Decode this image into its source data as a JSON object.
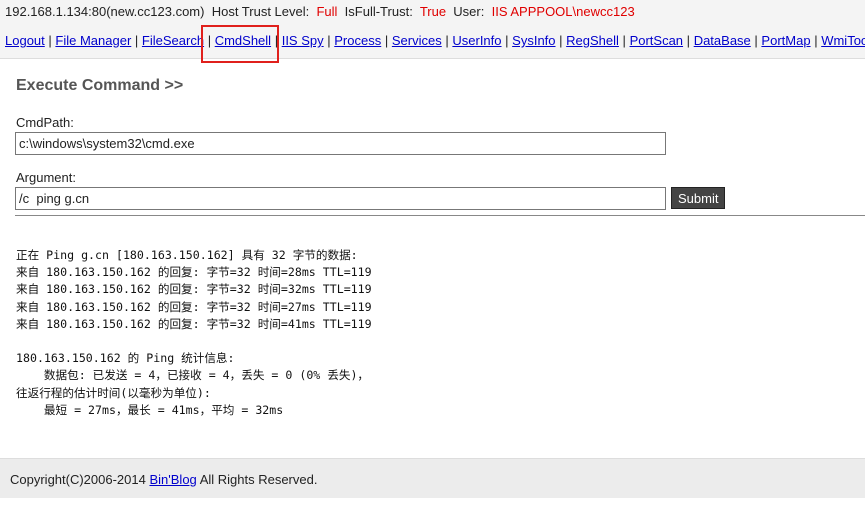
{
  "header": {
    "host": "192.168.1.134:80(new.cc123.com)",
    "trust_label": "Host Trust Level:",
    "trust_value": "Full",
    "full_trust_label": "IsFull-Trust:",
    "full_trust_value": "True",
    "user_label": "User:",
    "user_value": "IIS APPPOOL\\newcc123"
  },
  "nav": {
    "items": [
      {
        "label": "Logout"
      },
      {
        "label": "File Manager"
      },
      {
        "label": "FileSearch"
      },
      {
        "label": "CmdShell"
      },
      {
        "label": "IIS Spy"
      },
      {
        "label": "Process"
      },
      {
        "label": "Services"
      },
      {
        "label": "UserInfo"
      },
      {
        "label": "SysInfo"
      },
      {
        "label": "RegShell"
      },
      {
        "label": "PortScan"
      },
      {
        "label": "DataBase"
      },
      {
        "label": "PortMap"
      },
      {
        "label": "WmiTools"
      }
    ],
    "separator": "|",
    "highlight_color": "#e0201c"
  },
  "main": {
    "title": "Execute Command >>",
    "cmdpath_label": "CmdPath:",
    "cmdpath_value": "c:\\windows\\system32\\cmd.exe",
    "argument_label": "Argument:",
    "argument_value": "/c  ping g.cn",
    "submit_label": "Submit",
    "output_lines": [
      "正在 Ping g.cn [180.163.150.162] 具有 32 字节的数据:",
      "来自 180.163.150.162 的回复: 字节=32 时间=28ms TTL=119",
      "来自 180.163.150.162 的回复: 字节=32 时间=32ms TTL=119",
      "来自 180.163.150.162 的回复: 字节=32 时间=27ms TTL=119",
      "来自 180.163.150.162 的回复: 字节=32 时间=41ms TTL=119",
      "",
      "180.163.150.162 的 Ping 统计信息:",
      "    数据包: 已发送 = 4，已接收 = 4，丢失 = 0 (0% 丢失)，",
      "往返行程的估计时间(以毫秒为单位):",
      "    最短 = 27ms，最长 = 41ms，平均 = 32ms"
    ]
  },
  "footer": {
    "prefix": "Copyright(C)2006-2014",
    "link": "Bin'Blog",
    "suffix": "All Rights Reserved."
  },
  "colors": {
    "accent_red": "#e00000",
    "link_blue": "#0000cc"
  }
}
